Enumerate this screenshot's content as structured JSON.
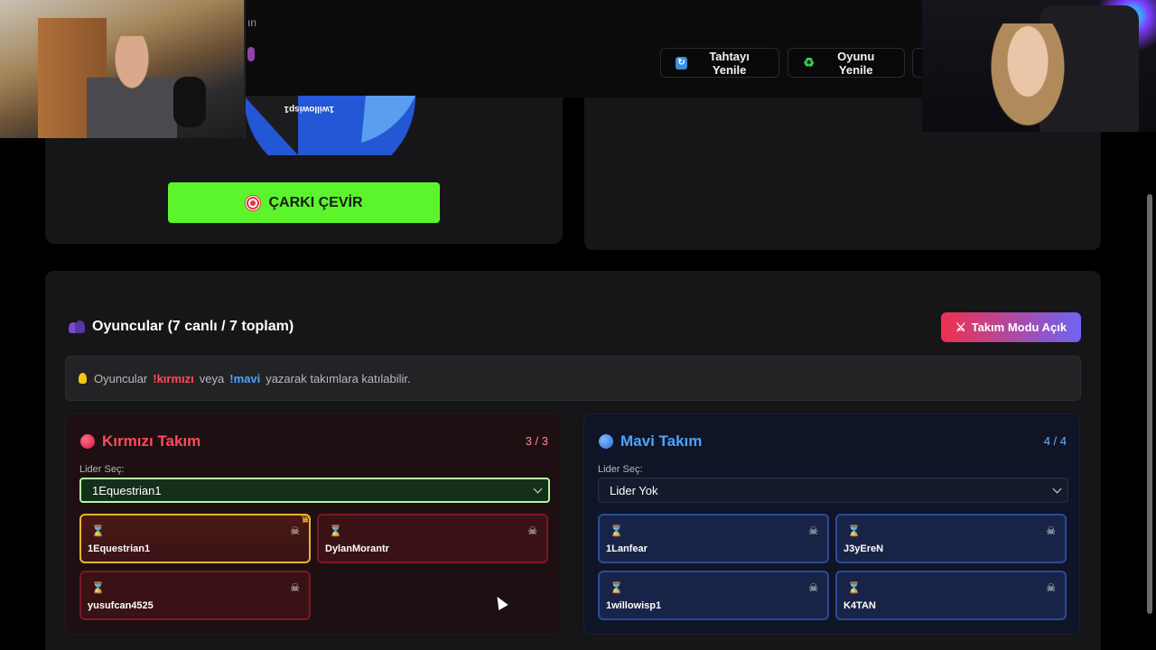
{
  "header": {
    "board_refresh_label": "Tahtayı Yenile",
    "game_refresh_label": "Oyunu Yenile",
    "partial_text": "ın"
  },
  "wheel": {
    "segment_label": "1willowisp1",
    "spin_label": "ÇARKI ÇEVİR"
  },
  "players": {
    "title": "Oyuncular (7 canlı / 7 toplam)",
    "team_mode_label": "Takım Modu Açık",
    "hint": {
      "prefix": "Oyuncular",
      "red_cmd": "!kırmızı",
      "mid": "veya",
      "blue_cmd": "!mavi",
      "suffix": "yazarak takımlara katılabilir."
    }
  },
  "teams": {
    "red": {
      "name": "Kırmızı Takım",
      "count": "3 / 3",
      "lider_label": "Lider Seç:",
      "selected_leader": "1Equestrian1",
      "players": [
        "1Equestrian1",
        "DylanMorantr",
        "yusufcan4525"
      ]
    },
    "blue": {
      "name": "Mavi Takım",
      "count": "4 / 4",
      "lider_label": "Lider Seç:",
      "selected_leader": "Lider Yok",
      "players": [
        "1Lanfear",
        "J3yEreN",
        "1willowisp1",
        "K4TAN"
      ]
    }
  },
  "colors": {
    "spin_button": "#5cf52c",
    "red_accent": "#ff4b5c",
    "blue_accent": "#4da3ff",
    "leader_border": "#f0b429"
  },
  "icons": {
    "board_refresh": "refresh-icon",
    "game_refresh": "recycle-icon",
    "spin": "target-icon",
    "players": "people-icon",
    "team_mode": "crossed-swords-icon",
    "hint": "lightbulb-icon",
    "status": "hourglass-icon",
    "kick": "skull-crossbones-icon",
    "leader": "crown-icon"
  }
}
